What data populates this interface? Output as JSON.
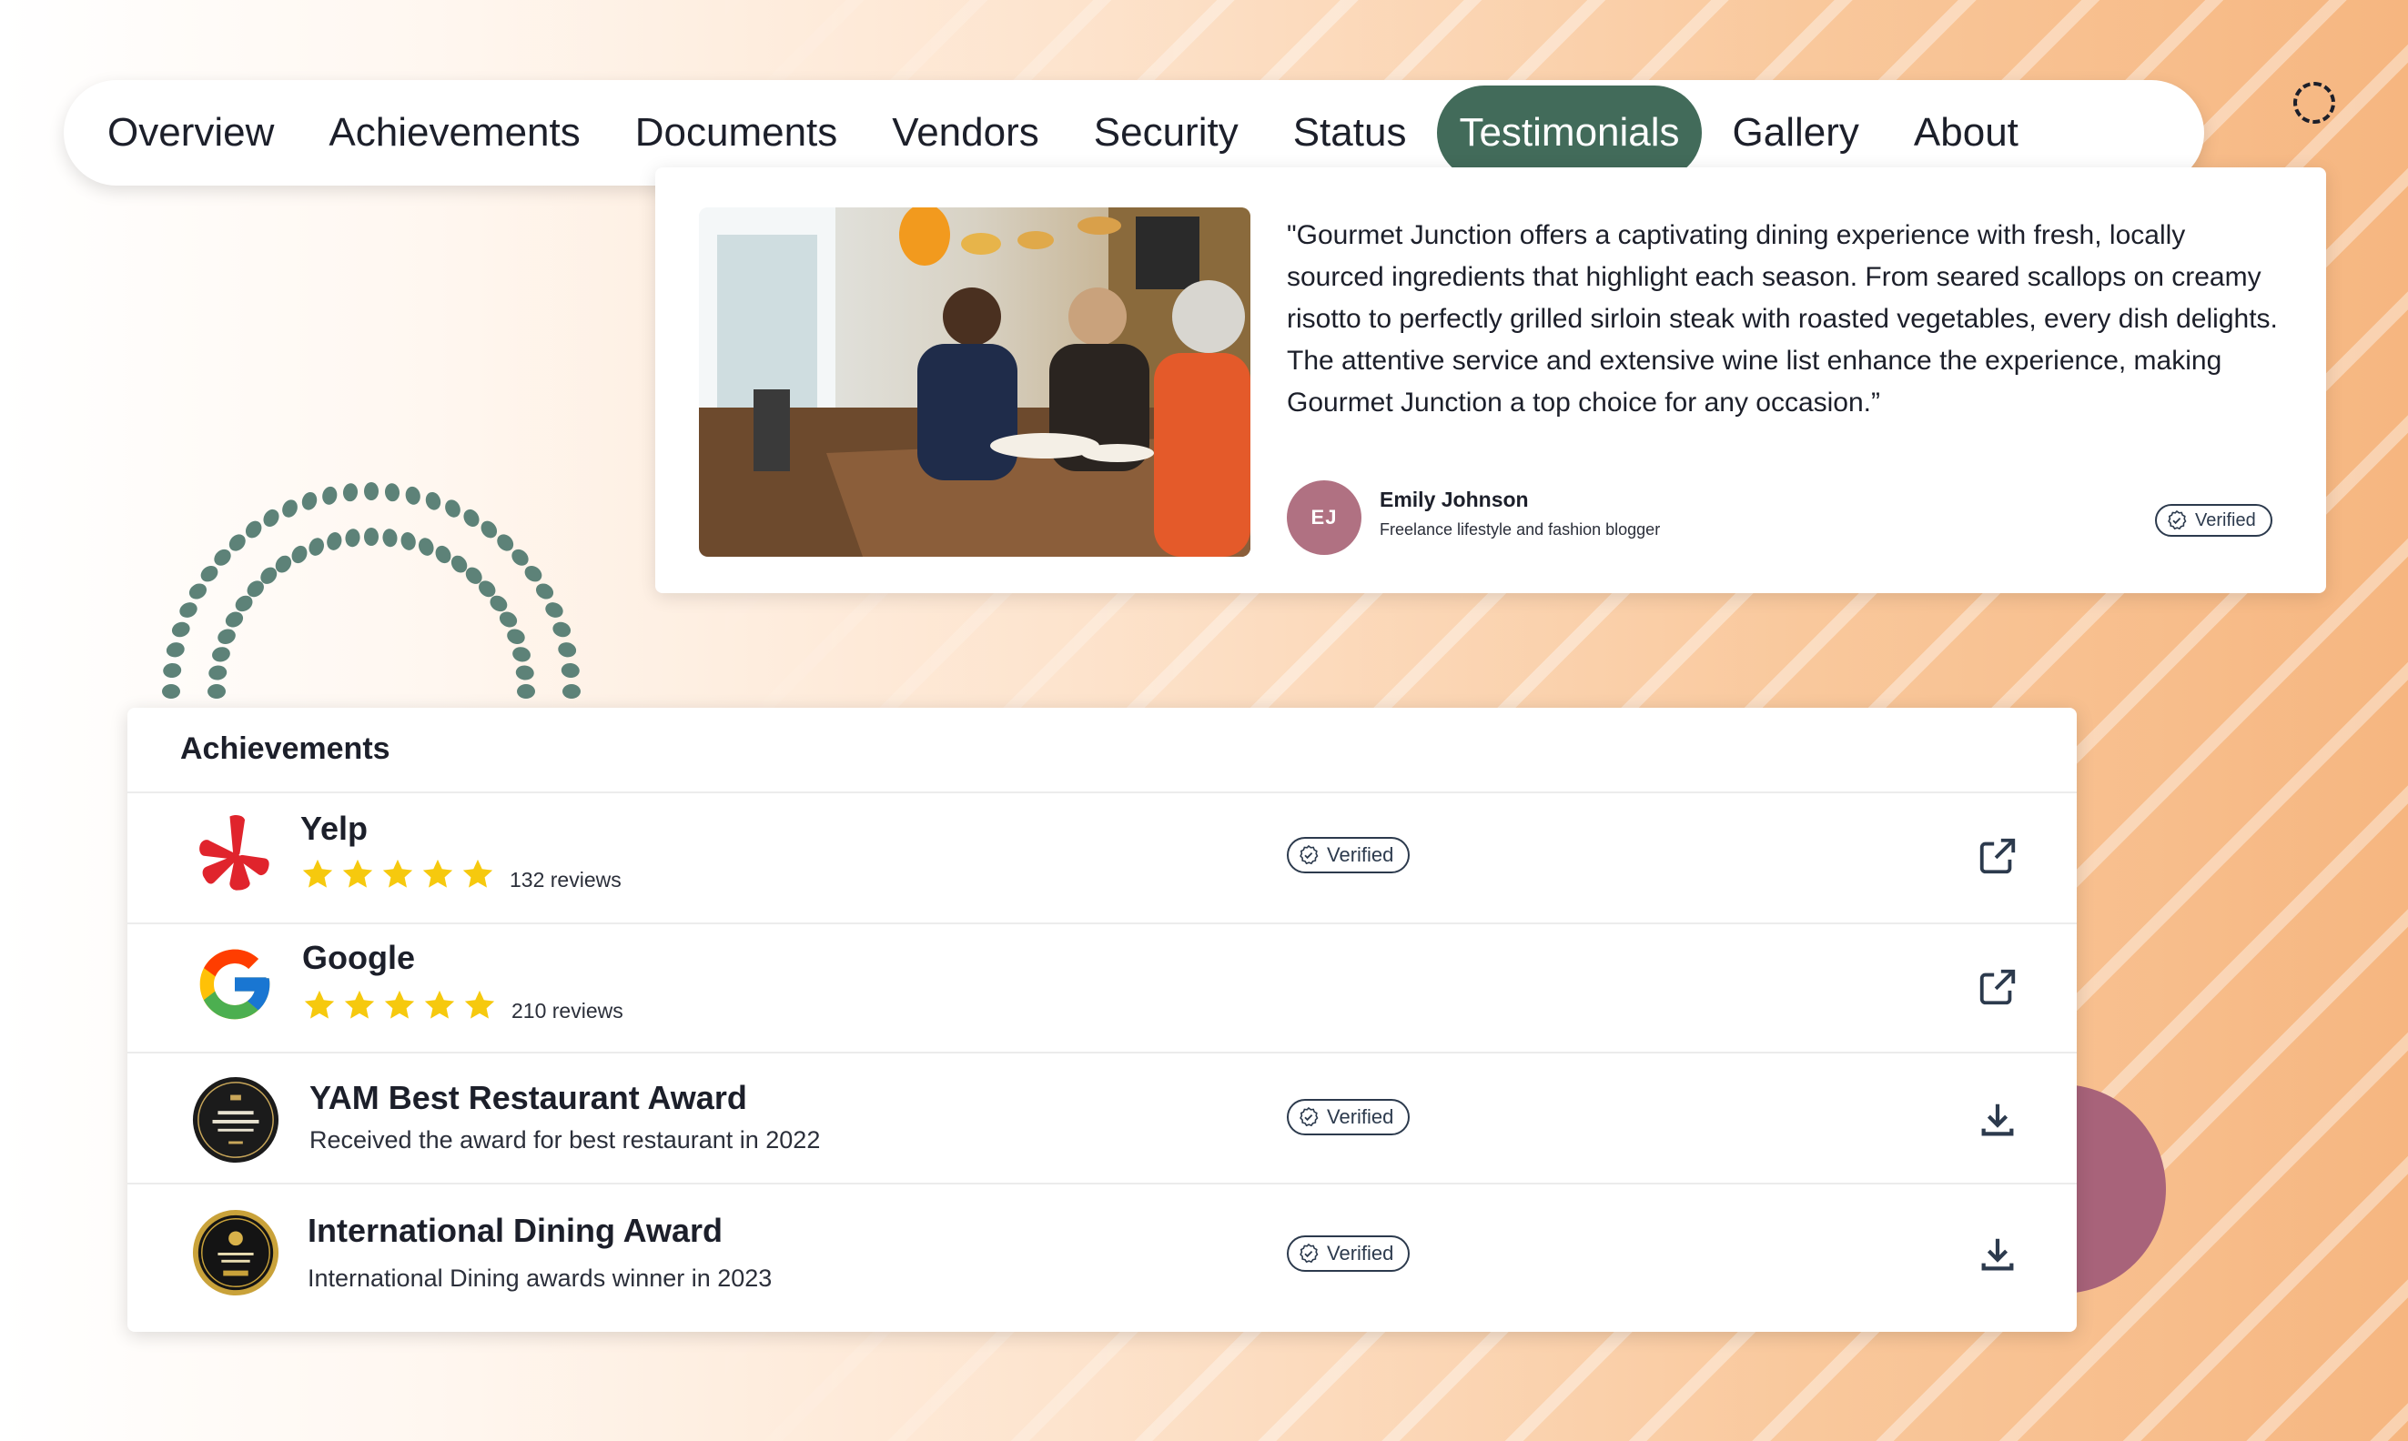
{
  "nav": {
    "tabs": [
      {
        "label": "Overview"
      },
      {
        "label": "Achievements"
      },
      {
        "label": "Documents"
      },
      {
        "label": "Vendors"
      },
      {
        "label": "Security"
      },
      {
        "label": "Status"
      },
      {
        "label": "Testimonials",
        "active": true
      },
      {
        "label": "Gallery"
      },
      {
        "label": "About"
      }
    ]
  },
  "testimonial": {
    "quote": "\"Gourmet Junction offers a captivating dining experience with fresh, locally sourced ingredients that highlight each season. From seared scallops on creamy risotto to perfectly grilled sirloin steak with roasted vegetables, every dish delights. The attentive service and extensive wine list enhance the experience, making Gourmet Junction a top choice for any occasion.”",
    "initials": "EJ",
    "name": "Emily Johnson",
    "role": "Freelance lifestyle and fashion blogger",
    "verified_label": "Verified"
  },
  "achievements": {
    "title": "Achievements",
    "items": [
      {
        "name": "Yelp",
        "rating": 5,
        "reviews": "132 reviews",
        "verified_label": "Verified",
        "action": "external-link-icon",
        "logo": "yelp-logo"
      },
      {
        "name": "Google",
        "rating": 5,
        "reviews": "210 reviews",
        "verified_label": "",
        "action": "external-link-icon",
        "logo": "google-logo"
      },
      {
        "name": "YAM Best Restaurant Award",
        "subtitle": "Received the award for best restaurant in 2022",
        "verified_label": "Verified",
        "action": "download-icon",
        "logo": "best-restaurant-award-badge"
      },
      {
        "name": "International Dining Award",
        "subtitle": "International Dining awards winner in 2023",
        "verified_label": "Verified",
        "action": "download-icon",
        "logo": "international-dining-award-badge"
      }
    ]
  },
  "colors": {
    "accent": "#426b5a",
    "avatar": "#b07182",
    "star": "#f6c90e",
    "decor": "#a8637a",
    "arc_dots": "#5d8278"
  }
}
